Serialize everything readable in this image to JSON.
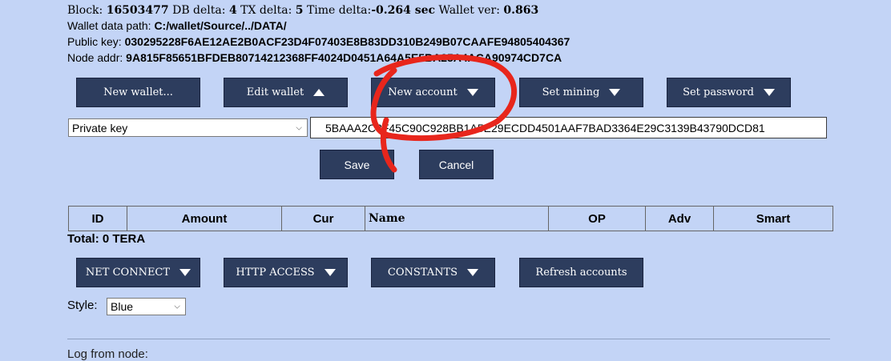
{
  "info": {
    "block_label": "Block:",
    "block_value": "16503477",
    "db_delta_label": "DB delta:",
    "db_delta_value": "4",
    "tx_delta_label": "TX delta:",
    "tx_delta_value": "5",
    "time_delta_label": "Time delta:",
    "time_delta_value": "-0.264 sec",
    "wallet_ver_label": "Wallet ver:",
    "wallet_ver_value": "0.863",
    "data_path_label": "Wallet data path:",
    "data_path_value": "C:/wallet/Source/../DATA/",
    "public_key_label": "Public key:",
    "public_key_value": "030295228F6AE12AE2B0ACF23D4F07403E8B83DD310B249B07CAAFE94805404367",
    "node_addr_label": "Node addr:",
    "node_addr_value": "9A815F85651BFDEB80714212368FF4024D0451A64A5E5BA25A4ACA90974CD7CA"
  },
  "toolbar": {
    "new_wallet": "New wallet...",
    "edit_wallet": "Edit wallet",
    "new_account": "New account",
    "set_mining": "Set mining",
    "set_password": "Set password"
  },
  "key_form": {
    "key_type_selected": "Private key",
    "key_value": "5BAAA2C3F45C90C928BB1A5E29ECDD4501AAF7BAD3364E29C3139B43790DCD81",
    "save_label": "Save",
    "cancel_label": "Cancel"
  },
  "accounts_table": {
    "columns": [
      "ID",
      "Amount",
      "Cur",
      "Name",
      "OP",
      "Adv",
      "Smart"
    ]
  },
  "total": "Total: 0 TERA",
  "bottom_toolbar": {
    "net_connect": "NET CONNECT",
    "http_access": "HTTP ACCESS",
    "constants": "CONSTANTS",
    "refresh_accounts": "Refresh accounts"
  },
  "style": {
    "label": "Style:",
    "selected": "Blue"
  },
  "log_label": "Log from node:",
  "colors": {
    "background": "#c3d4f6",
    "button": "#2d3d5e",
    "annotation": "#e8261c"
  }
}
